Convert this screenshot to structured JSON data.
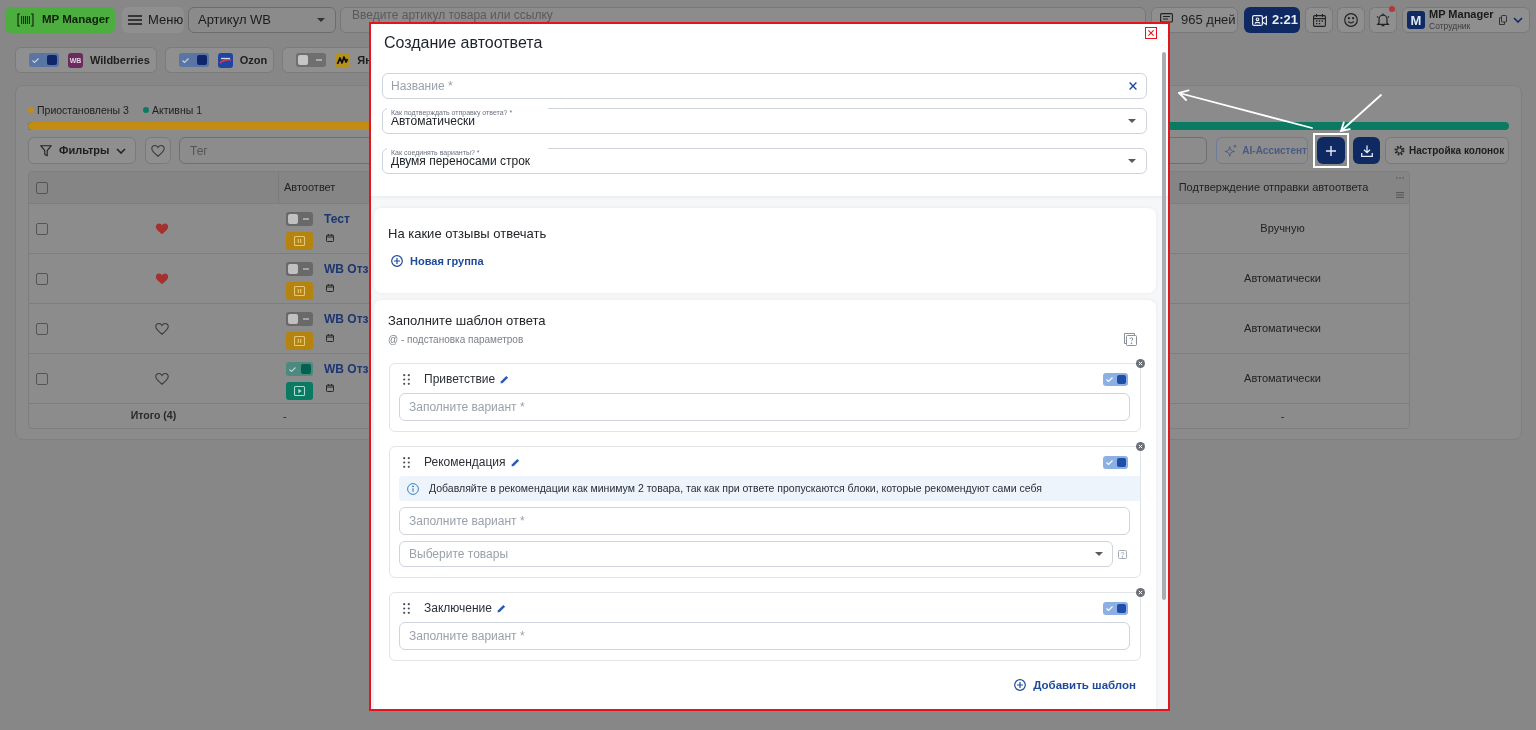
{
  "top_bar": {
    "logo": {
      "label": "MP Manager"
    },
    "menu_button": {
      "label": "Меню"
    },
    "article_select": {
      "value": "Артикул WB"
    },
    "search": {
      "placeholder": "Введите артикул товара или ссылку"
    },
    "subscription": {
      "label": "965 дней"
    },
    "call_button": {
      "label": "2:21"
    },
    "notifications": {
      "unread": true
    },
    "user": {
      "avatar": "M",
      "name": "MP Manager",
      "role": "Сотрудник"
    }
  },
  "marketplaces": [
    {
      "kind": "wb",
      "logo_text": "WB",
      "label": "Wildberries",
      "on": true
    },
    {
      "kind": "ozon",
      "label": "Ozon",
      "on": true
    },
    {
      "kind": "yandex",
      "label": "Ян",
      "on": false
    }
  ],
  "summary": {
    "legend": [
      {
        "label": "Приостановлены 3",
        "color": "#c28b14"
      },
      {
        "label": "Активны 1",
        "color": "#0b7a63"
      }
    ],
    "progress": {
      "level": 0.75
    }
  },
  "toolbar": {
    "filters": {
      "label": "Фильтры"
    },
    "tag_field": {
      "placeholder": "Тег"
    },
    "ai_button": {
      "label": "AI-Ассистент"
    },
    "add_button": {
      "highlighted": true,
      "pointed_at": true
    },
    "column_settings": {
      "label": "Настройка колонок"
    }
  },
  "table": {
    "select_all": {
      "checked": false
    },
    "columns": [
      "Автоответ",
      "Подтверждение отправки автоответа"
    ],
    "rows": [
      {
        "checked": false,
        "favorite": true,
        "enabled": false,
        "active": false,
        "name": "Тест",
        "confirmation": "Вручную"
      },
      {
        "checked": false,
        "favorite": true,
        "enabled": false,
        "active": false,
        "name": "WB Отз",
        "confirmation": "Автоматически"
      },
      {
        "checked": false,
        "favorite": false,
        "enabled": false,
        "active": false,
        "name": "WB Отз",
        "confirmation": "Автоматически"
      },
      {
        "checked": false,
        "favorite": false,
        "enabled": true,
        "active": true,
        "name": "WB Отз",
        "confirmation": "Автоматически"
      }
    ],
    "footer": {
      "label": "Итого (4)",
      "cells": [
        "-",
        "-"
      ]
    }
  },
  "modal": {
    "highlighted": true,
    "pointed_at": true,
    "title": "Создание автоответа",
    "name_field": {
      "placeholder": "Название *"
    },
    "selects": [
      {
        "label": "Как подтверждать отправку ответа? *",
        "value": "Автоматически"
      },
      {
        "label": "Как соединять варианты? *",
        "value": "Двумя переносами строк"
      }
    ],
    "reviews_section": {
      "title": "На какие отзывы отвечать",
      "add_group": "Новая группа"
    },
    "template_section": {
      "title": "Заполните шаблон ответа",
      "hint": "@ - подстановка параметров",
      "blocks": [
        {
          "title": "Приветствие",
          "enabled": true,
          "variant_placeholder": "Заполните вариант *"
        },
        {
          "title": "Рекомендация",
          "enabled": true,
          "info": "Добавляйте в рекомендации как минимум 2 товара, так как при ответе пропускаются блоки, которые рекомендуют сами себя",
          "variant_placeholder": "Заполните вариант *",
          "products_placeholder": "Выберите товары"
        },
        {
          "title": "Заключение",
          "enabled": true,
          "variant_placeholder": "Заполните вариант *"
        }
      ],
      "add_template": "Добавить шаблон"
    }
  }
}
